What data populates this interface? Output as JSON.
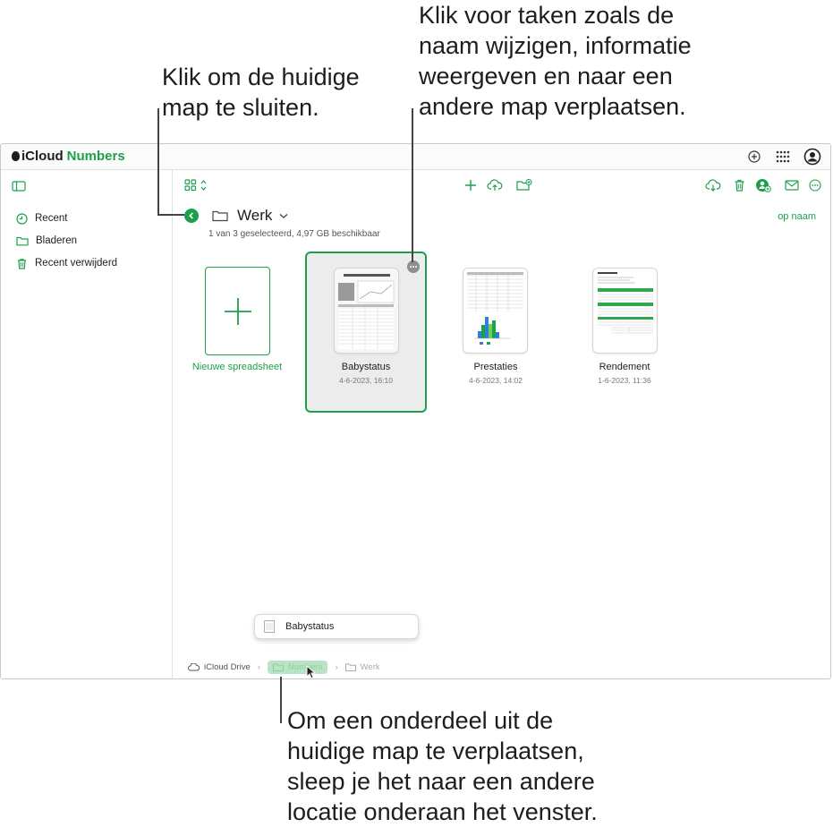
{
  "callouts": {
    "close_folder": [
      "Klik om de huidige",
      "map te sluiten."
    ],
    "more_actions": [
      "Klik voor taken zoals de",
      "naam wijzigen, informatie",
      "weergeven en naar een",
      "andere map verplaatsen."
    ],
    "move_item": [
      "Om een onderdeel uit de",
      "huidige map te verplaatsen,",
      "sleep je het naar een andere",
      "locatie onderaan het venster."
    ]
  },
  "topbar": {
    "brand_icloud": "iCloud",
    "brand_app": "Numbers",
    "icons": [
      "add-circle-icon",
      "app-grid-icon",
      "account-icon"
    ]
  },
  "sidebar": {
    "items": [
      {
        "label": "Recent",
        "icon": "clock-icon"
      },
      {
        "label": "Bladeren",
        "icon": "folder-icon"
      },
      {
        "label": "Recent verwijderd",
        "icon": "trash-icon"
      }
    ]
  },
  "toolbar": {
    "center_icons": [
      "plus-icon",
      "upload-icon",
      "new-folder-icon"
    ],
    "right_icons": [
      "download-icon",
      "trash-icon",
      "collaborate-icon",
      "mail-icon",
      "more-icon"
    ]
  },
  "folder": {
    "title": "Werk",
    "status": "1 van 3 geselecteerd, 4,97 GB beschikbaar",
    "sort_label": "op naam"
  },
  "files": {
    "new_label": "Nieuwe spreadsheet",
    "items": [
      {
        "name": "Babystatus",
        "date": "4-6-2023, 16:10"
      },
      {
        "name": "Prestaties",
        "date": "4-6-2023, 14:02"
      },
      {
        "name": "Rendement",
        "date": "1-6-2023, 11:36"
      }
    ]
  },
  "drag": {
    "label": "Babystatus"
  },
  "breadcrumbs": [
    "iCloud Drive",
    "Numbers",
    "Werk"
  ],
  "colors": {
    "accent": "#1da04a",
    "highlight": "#b9e3c4"
  }
}
